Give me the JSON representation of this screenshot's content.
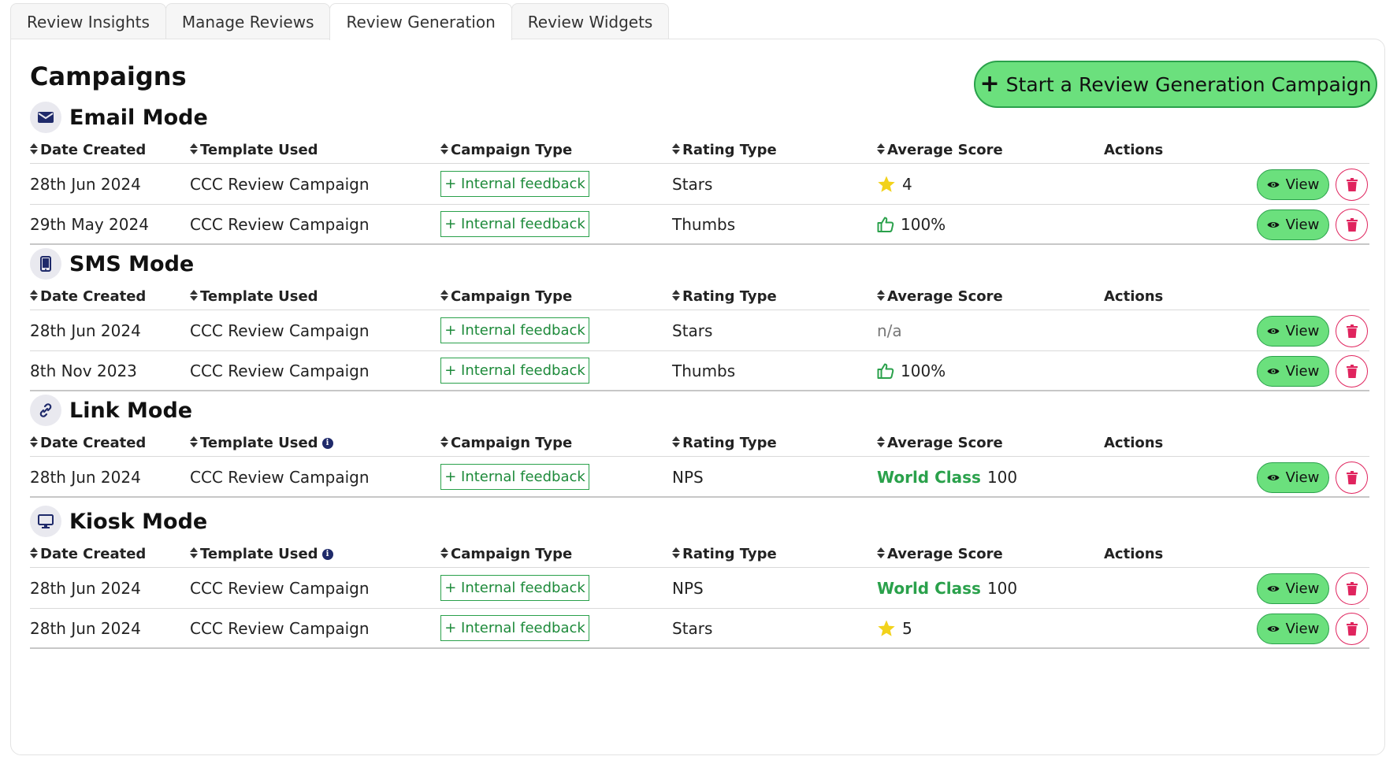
{
  "tabs": [
    {
      "label": "Review Insights"
    },
    {
      "label": "Manage Reviews"
    },
    {
      "label": "Review Generation"
    },
    {
      "label": "Review Widgets"
    }
  ],
  "active_tab": "Review Generation",
  "page_title": "Campaigns",
  "start_button": {
    "plus": "+",
    "label": "Start a Review Generation Campaign"
  },
  "columns": {
    "date": "Date Created",
    "template": "Template Used",
    "type": "Campaign Type",
    "rating": "Rating Type",
    "score": "Average Score",
    "actions": "Actions"
  },
  "actions": {
    "view_label": "View"
  },
  "sections": [
    {
      "title": "Email Mode",
      "icon": "envelope-icon",
      "rows": [
        {
          "date": "28th Jun 2024",
          "template": "CCC Review Campaign",
          "type": "+ Internal feedback",
          "rating": "Stars",
          "score": "4",
          "score_kind": "star"
        },
        {
          "date": "29th May 2024",
          "template": "CCC Review Campaign",
          "type": "+ Internal feedback",
          "rating": "Thumbs",
          "score": "100%",
          "score_kind": "thumb"
        }
      ]
    },
    {
      "title": "SMS Mode",
      "icon": "mobile-phone-icon",
      "rows": [
        {
          "date": "28th Jun 2024",
          "template": "CCC Review Campaign",
          "type": "+ Internal feedback",
          "rating": "Stars",
          "score": "n/a",
          "score_kind": "na"
        },
        {
          "date": "8th Nov 2023",
          "template": "CCC Review Campaign",
          "type": "+ Internal feedback",
          "rating": "Thumbs",
          "score": "100%",
          "score_kind": "thumb"
        }
      ]
    },
    {
      "title": "Link Mode",
      "icon": "link-icon",
      "rows": [
        {
          "date": "28th Jun 2024",
          "template": "CCC Review Campaign",
          "type": "+ Internal feedback",
          "rating": "NPS",
          "score_label": "World Class",
          "score": "100",
          "score_kind": "nps"
        }
      ]
    },
    {
      "title": "Kiosk Mode",
      "icon": "monitor-icon",
      "rows": [
        {
          "date": "28th Jun 2024",
          "template": "CCC Review Campaign",
          "type": "+ Internal feedback",
          "rating": "NPS",
          "score_label": "World Class",
          "score": "100",
          "score_kind": "nps"
        },
        {
          "date": "28th Jun 2024",
          "template": "CCC Review Campaign",
          "type": "+ Internal feedback",
          "rating": "Stars",
          "score": "5",
          "score_kind": "star"
        }
      ]
    }
  ],
  "colors": {
    "accent_green": "#6be07d",
    "green_text": "#1d8a3a",
    "delete_red": "#e0245e",
    "icon_navy": "#1f2a6a",
    "star_yellow": "#f2d21b"
  }
}
